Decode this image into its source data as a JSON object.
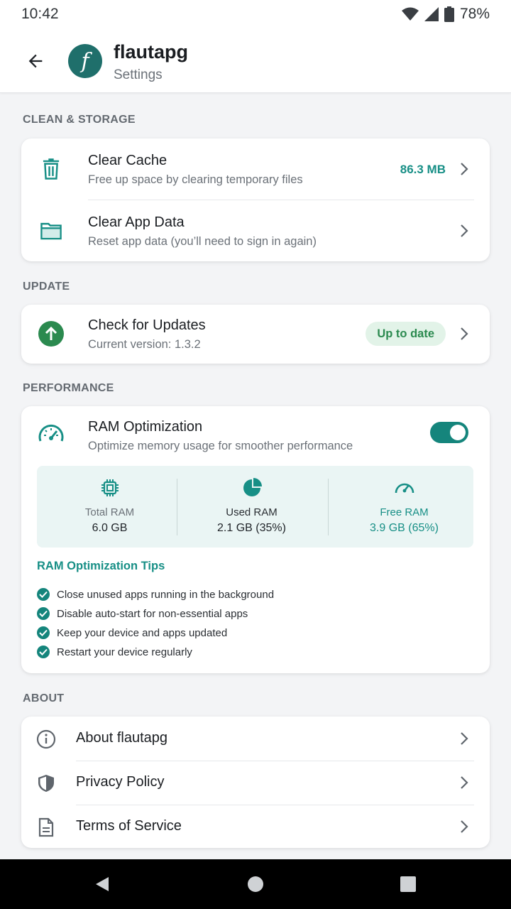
{
  "status": {
    "time": "10:42",
    "battery": "78%"
  },
  "header": {
    "logo_letter": "f",
    "title": "flautapg",
    "subtitle": "Settings"
  },
  "sections": {
    "clean": "CLEAN & STORAGE",
    "update": "UPDATE",
    "performance": "PERFORMANCE",
    "about": "ABOUT"
  },
  "clean": {
    "cache_title": "Clear Cache",
    "cache_sub": "Free up space by clearing temporary files",
    "cache_value": "86.3 MB",
    "data_title": "Clear App Data",
    "data_sub": "Reset app data (you’ll need to sign in again)"
  },
  "update": {
    "title": "Check for Updates",
    "sub": "Current version: 1.3.2",
    "badge": "Up to date"
  },
  "performance": {
    "title": "RAM Optimization",
    "sub": "Optimize memory usage for smoother performance",
    "toggle_on": true,
    "total_label": "Total RAM",
    "total_value": "6.0 GB",
    "used_label": "Used RAM",
    "used_value": "2.1 GB (35%)",
    "free_label": "Free RAM",
    "free_value": "3.9 GB (65%)",
    "tips_title": "RAM Optimization Tips",
    "tips": [
      "Close unused apps running in the background",
      "Disable auto-start for non-essential apps",
      "Keep your device and apps updated",
      "Restart your device regularly"
    ]
  },
  "about": {
    "items": [
      "About flautapg",
      "Privacy Policy",
      "Terms of Service"
    ]
  },
  "colors": {
    "accent": "#15857c",
    "success": "#2b8a4f",
    "logo_bg": "#1f6f6b"
  }
}
